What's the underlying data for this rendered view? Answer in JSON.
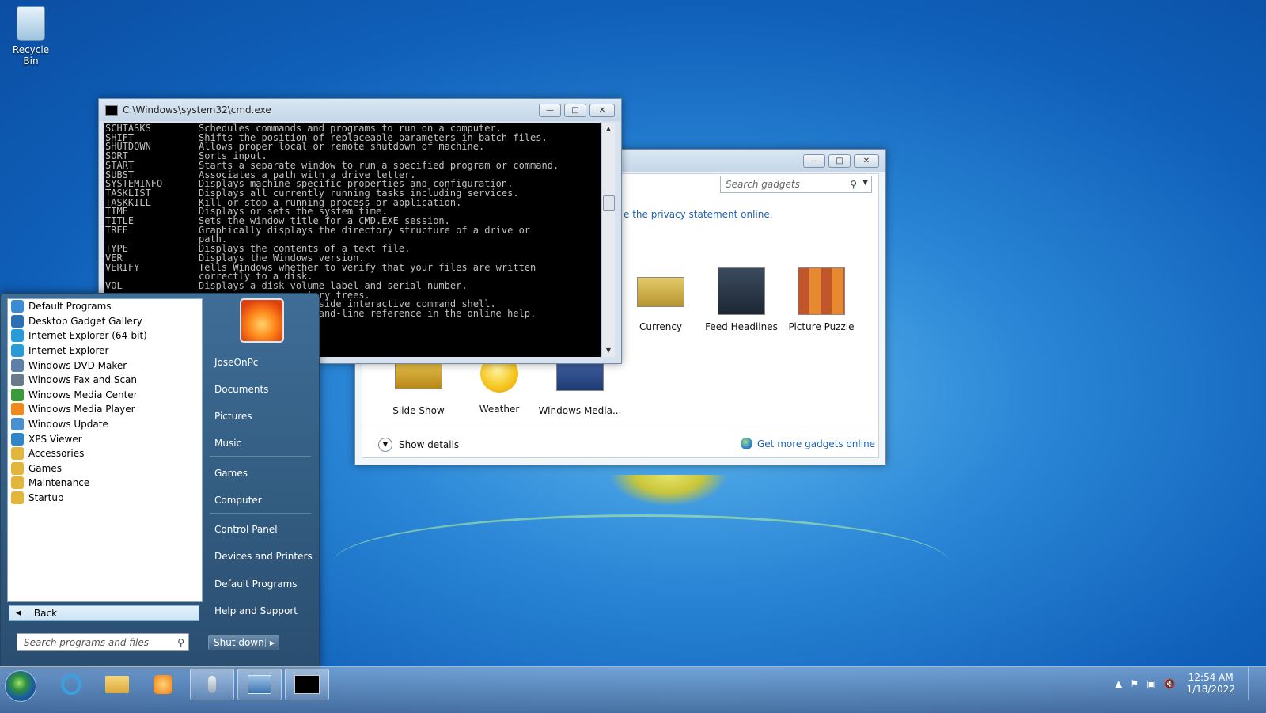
{
  "desktop": {
    "icons": [
      {
        "label": "Recycle Bin",
        "icon": "recycle-bin-icon"
      }
    ]
  },
  "cmd": {
    "title": "C:\\Windows\\system32\\cmd.exe",
    "lines": [
      [
        "SCHTASKS",
        "Schedules commands and programs to run on a computer."
      ],
      [
        "SHIFT",
        "Shifts the position of replaceable parameters in batch files."
      ],
      [
        "SHUTDOWN",
        "Allows proper local or remote shutdown of machine."
      ],
      [
        "SORT",
        "Sorts input."
      ],
      [
        "START",
        "Starts a separate window to run a specified program or command."
      ],
      [
        "SUBST",
        "Associates a path with a drive letter."
      ],
      [
        "SYSTEMINFO",
        "Displays machine specific properties and configuration."
      ],
      [
        "TASKLIST",
        "Displays all currently running tasks including services."
      ],
      [
        "TASKKILL",
        "Kill or stop a running process or application."
      ],
      [
        "TIME",
        "Displays or sets the system time."
      ],
      [
        "TITLE",
        "Sets the window title for a CMD.EXE session."
      ],
      [
        "TREE",
        "Graphically displays the directory structure of a drive or"
      ],
      [
        "",
        "path."
      ],
      [
        "TYPE",
        "Displays the contents of a text file."
      ],
      [
        "VER",
        "Displays the Windows version."
      ],
      [
        "VERIFY",
        "Tells Windows whether to verify that your files are written"
      ],
      [
        "",
        "correctly to a disk."
      ],
      [
        "VOL",
        "Displays a disk volume label and serial number."
      ],
      [
        "",
        "                 ectory trees."
      ],
      [
        "",
        "             ation inside interactive command shell."
      ],
      [
        "",
        ""
      ],
      [
        "",
        "             the command-line reference in the online help."
      ]
    ]
  },
  "gallery": {
    "search_placeholder": "Search gadgets",
    "privacy_text": "e the privacy statement online.",
    "gadgets_row1": [
      {
        "label": "Currency",
        "color": "#c9a948"
      },
      {
        "label": "Feed Headlines",
        "color": "#2b3a4c"
      },
      {
        "label": "Picture Puzzle",
        "color": "#8a4a1d"
      }
    ],
    "gadgets_row2": [
      {
        "label": "Slide Show",
        "color": "#d9a21c"
      },
      {
        "label": "Weather",
        "color": "#f4c21e"
      },
      {
        "label": "Windows Media...",
        "color": "#2a4f8f"
      }
    ],
    "show_details": "Show details",
    "more_gadgets": "Get more gadgets online"
  },
  "start_menu": {
    "programs": [
      {
        "label": "Default Programs",
        "color": "#3a8bd6"
      },
      {
        "label": "Desktop Gadget Gallery",
        "color": "#2d6fb5"
      },
      {
        "label": "Internet Explorer (64-bit)",
        "color": "#2a9bd8"
      },
      {
        "label": "Internet Explorer",
        "color": "#2a9bd8"
      },
      {
        "label": "Windows DVD Maker",
        "color": "#5d7fa8"
      },
      {
        "label": "Windows Fax and Scan",
        "color": "#6a7a8a"
      },
      {
        "label": "Windows Media Center",
        "color": "#3b9a3c"
      },
      {
        "label": "Windows Media Player",
        "color": "#f08a1e"
      },
      {
        "label": "Windows Update",
        "color": "#4a8fd0"
      },
      {
        "label": "XPS Viewer",
        "color": "#2c86c9"
      },
      {
        "label": "Accessories",
        "color": "#e3b53b"
      },
      {
        "label": "Games",
        "color": "#e3b53b"
      },
      {
        "label": "Maintenance",
        "color": "#e3b53b"
      },
      {
        "label": "Startup",
        "color": "#e3b53b"
      }
    ],
    "back_label": "Back",
    "search_placeholder": "Search programs and files",
    "right_items": [
      "JoseOnPc",
      "Documents",
      "Pictures",
      "Music",
      "Games",
      "Computer",
      "Control Panel",
      "Devices and Printers",
      "Default Programs",
      "Help and Support"
    ],
    "shutdown_label": "Shut down"
  },
  "taskbar": {
    "time": "12:54 AM",
    "date": "1/18/2022"
  }
}
